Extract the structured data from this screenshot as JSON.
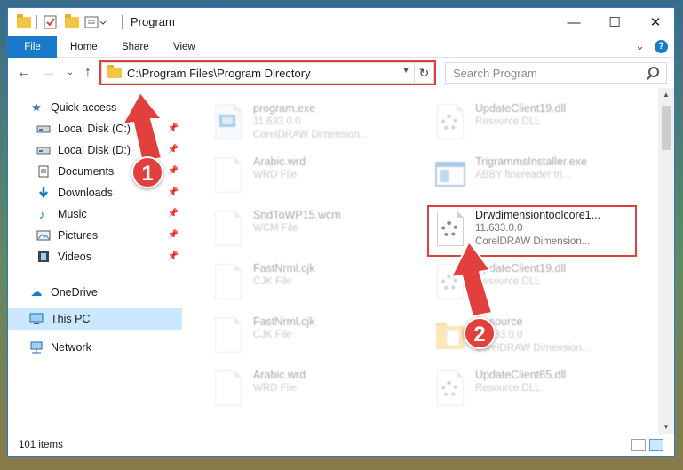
{
  "window": {
    "title": "Program",
    "controls": {
      "minimize": "—",
      "maximize": "☐",
      "close": "✕"
    }
  },
  "ribbon": {
    "tabs": [
      "File",
      "Home",
      "Share",
      "View"
    ],
    "expand_glyph": "⌄",
    "help": "?"
  },
  "address_bar": {
    "path": "C:\\Program Files\\Program Directory",
    "search_placeholder": "Search Program"
  },
  "navigation": {
    "quick_access_label": "Quick access",
    "items": [
      {
        "label": "Local Disk (C:)",
        "icon": "drive-icon",
        "pinned": true
      },
      {
        "label": "Local Disk (D:)",
        "icon": "drive-icon",
        "pinned": true
      },
      {
        "label": "Documents",
        "icon": "documents-icon",
        "pinned": true
      },
      {
        "label": "Downloads",
        "icon": "downloads-icon",
        "pinned": true
      },
      {
        "label": "Music",
        "icon": "music-icon",
        "pinned": true
      },
      {
        "label": "Pictures",
        "icon": "pictures-icon",
        "pinned": true
      },
      {
        "label": "Videos",
        "icon": "videos-icon",
        "pinned": true
      }
    ],
    "onedrive_label": "OneDrive",
    "this_pc_label": "This PC",
    "network_label": "Network"
  },
  "files": [
    {
      "name": "program.exe",
      "line2": "11.633.0.0",
      "line3": "CorelDRAW Dimension...",
      "icon": "exe-icon",
      "highlighted": false
    },
    {
      "name": "UpdateClient19.dll",
      "line2": "Resource DLL",
      "line3": "",
      "icon": "dll-gear-icon",
      "highlighted": false
    },
    {
      "name": "Arabic.wrd",
      "line2": "WRD File",
      "line3": "",
      "icon": "file-icon",
      "highlighted": false
    },
    {
      "name": "TrigrammsInstaller.exe",
      "line2": "ABBY finereader tri...",
      "line3": "",
      "icon": "exe-window-icon",
      "highlighted": false
    },
    {
      "name": "SndToWP15.wcm",
      "line2": "WCM File",
      "line3": "",
      "icon": "file-icon",
      "highlighted": false
    },
    {
      "name": "Drwdimensiontoolcore1...",
      "line2": "11.633.0.0",
      "line3": "CorelDRAW Dimension...",
      "icon": "dll-gear-icon",
      "highlighted": true
    },
    {
      "name": "FastNrml.cjk",
      "line2": "CJK File",
      "line3": "",
      "icon": "file-icon",
      "highlighted": false
    },
    {
      "name": "UpdateClient19.dll",
      "line2": "Resource DLL",
      "line3": "",
      "icon": "dll-gear-icon",
      "highlighted": false
    },
    {
      "name": "FastNrml.cjk",
      "line2": "CJK File",
      "line3": "",
      "icon": "file-icon",
      "highlighted": false
    },
    {
      "name": "Resource",
      "line2": "11.633.0.0",
      "line3": "CorelDRAW Dimension...",
      "icon": "folder-icon",
      "highlighted": false
    },
    {
      "name": "Arabic.wrd",
      "line2": "WRD File",
      "line3": "",
      "icon": "file-icon",
      "highlighted": false
    },
    {
      "name": "UpdateClient65.dll",
      "line2": "Resource DLL",
      "line3": "",
      "icon": "dll-gear-icon",
      "highlighted": false
    }
  ],
  "status_bar": {
    "item_count": "101 items"
  },
  "annotations": {
    "step1": "1",
    "step2": "2",
    "color": "#e1403c"
  }
}
